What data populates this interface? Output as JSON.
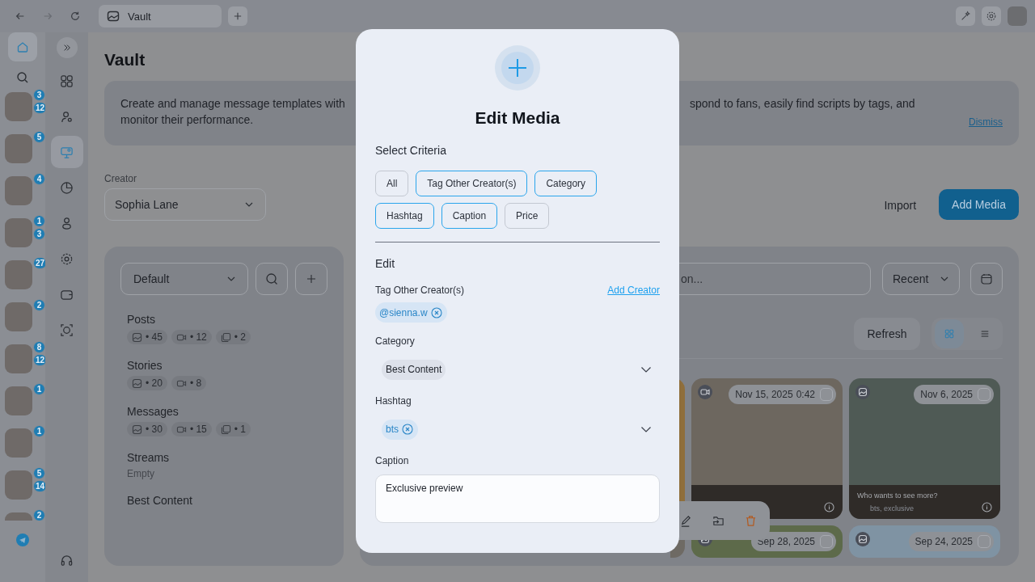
{
  "browser": {
    "tab_title": "Vault"
  },
  "rail": {
    "home": {
      "selected": true
    },
    "avatars": [
      {
        "badges": [
          "3",
          "12"
        ]
      },
      {
        "badges": [
          "5"
        ]
      },
      {
        "badges": [
          "4"
        ]
      },
      {
        "badges": [
          "1",
          "3"
        ]
      },
      {
        "badges": [
          "27"
        ]
      },
      {
        "badges": [
          "2"
        ]
      },
      {
        "badges": [
          "8",
          "12"
        ]
      },
      {
        "badges": [
          "1"
        ]
      },
      {
        "badges": [
          "1"
        ]
      },
      {
        "badges": [
          "5",
          "14"
        ]
      },
      {
        "badges": [
          "2"
        ]
      }
    ]
  },
  "nav": [
    {
      "selected": false
    },
    {
      "selected": false
    },
    {
      "selected": true
    },
    {
      "selected": false
    },
    {
      "selected": false
    },
    {
      "selected": false
    },
    {
      "selected": false
    },
    {
      "selected": false
    }
  ],
  "page": {
    "title": "Vault",
    "banner": {
      "text_left": "Create and manage message templates with",
      "text_left_2": "monitor their performance.",
      "text_right": "spond to fans, easily find scripts by tags, and",
      "dismiss": "Dismiss"
    },
    "creator": {
      "label": "Creator",
      "value": "Sophia Lane"
    },
    "import": "Import",
    "add_media": "Add Media"
  },
  "folders": {
    "select": "Default",
    "groups": [
      {
        "name": "Posts",
        "counts": [
          {
            "kind": "photo",
            "text": "• 45"
          },
          {
            "kind": "video",
            "text": "• 12"
          },
          {
            "kind": "gallery",
            "text": "• 2"
          }
        ]
      },
      {
        "name": "Stories",
        "counts": [
          {
            "kind": "photo",
            "text": "• 20"
          },
          {
            "kind": "video",
            "text": "• 8"
          }
        ]
      },
      {
        "name": "Messages",
        "counts": [
          {
            "kind": "photo",
            "text": "• 30"
          },
          {
            "kind": "video",
            "text": "• 15"
          },
          {
            "kind": "gallery",
            "text": "• 1"
          }
        ]
      },
      {
        "name": "Streams",
        "empty": "Empty"
      },
      {
        "name": "Best Content"
      }
    ]
  },
  "media": {
    "search_placeholder": "on...",
    "sort": "Recent",
    "refresh": "Refresh",
    "views": [
      {
        "selected": true
      },
      {
        "selected": false
      }
    ],
    "cards": [
      {
        "kind": "video",
        "date": "Nov 15, 2025",
        "duration": "0:42",
        "checked": false
      },
      {
        "kind": "photo",
        "date": "Nov 6, 2025",
        "checked": false,
        "caption": "Who wants to see more?",
        "tags": "bts, exclusive"
      },
      {
        "kind": "photo",
        "date": "Sep 28, 2025",
        "checked": false
      },
      {
        "kind": "photo",
        "date": "Sep 24, 2025",
        "checked": false
      }
    ]
  },
  "modal": {
    "title": "Edit Media",
    "criteria_label": "Select Criteria",
    "criteria": [
      {
        "label": "All",
        "selected": false
      },
      {
        "label": "Tag Other Creator(s)",
        "selected": true
      },
      {
        "label": "Category",
        "selected": true
      },
      {
        "label": "Hashtag",
        "selected": true
      },
      {
        "label": "Caption",
        "selected": true
      },
      {
        "label": "Price",
        "selected": false
      }
    ],
    "edit_label": "Edit",
    "tag_creators": {
      "label": "Tag Other Creator(s)",
      "link": "Add Creator",
      "chips": [
        "@sienna.w"
      ]
    },
    "category": {
      "label": "Category",
      "chips": [
        "Best Content"
      ]
    },
    "hashtag": {
      "label": "Hashtag",
      "chips": [
        "bts"
      ]
    },
    "caption": {
      "label": "Caption",
      "value": "Exclusive preview"
    }
  }
}
